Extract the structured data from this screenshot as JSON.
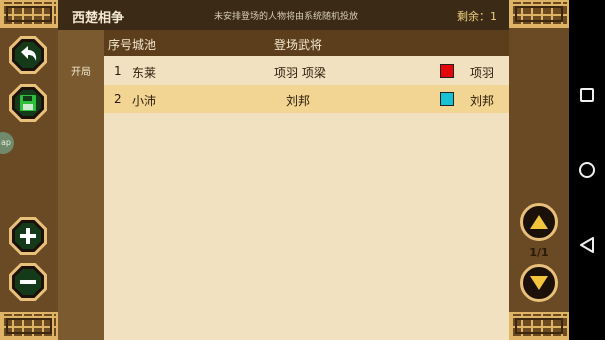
{
  "header": {
    "title": "西楚相争",
    "subtitle": "未安排登场的人物将由系统随机投放",
    "remaining": "剩余：1"
  },
  "tabs": [
    {
      "label": "开局"
    }
  ],
  "table": {
    "columns": [
      "序号",
      "城池",
      "登场武将"
    ],
    "rows": [
      {
        "index": "1",
        "city": "东莱",
        "generals": "项羽 项梁",
        "color": "#e4080a",
        "faction": "项羽"
      },
      {
        "index": "2",
        "city": "小沛",
        "generals": "刘邦",
        "color": "#18c1d3",
        "faction": "刘邦"
      }
    ]
  },
  "pager": {
    "page": "1/1"
  },
  "plugin_badge": {
    "text": "ap"
  },
  "icons": {
    "back": "back-arrow-icon",
    "save": "floppy-save-icon",
    "plus": "plus-icon",
    "minus": "minus-icon",
    "up": "triangle-up-icon",
    "down": "triangle-down-icon"
  },
  "colors": {
    "accent_gold": "#e8c079",
    "header_bg": "#3a2a16",
    "row_highlight": "#f2d593"
  }
}
